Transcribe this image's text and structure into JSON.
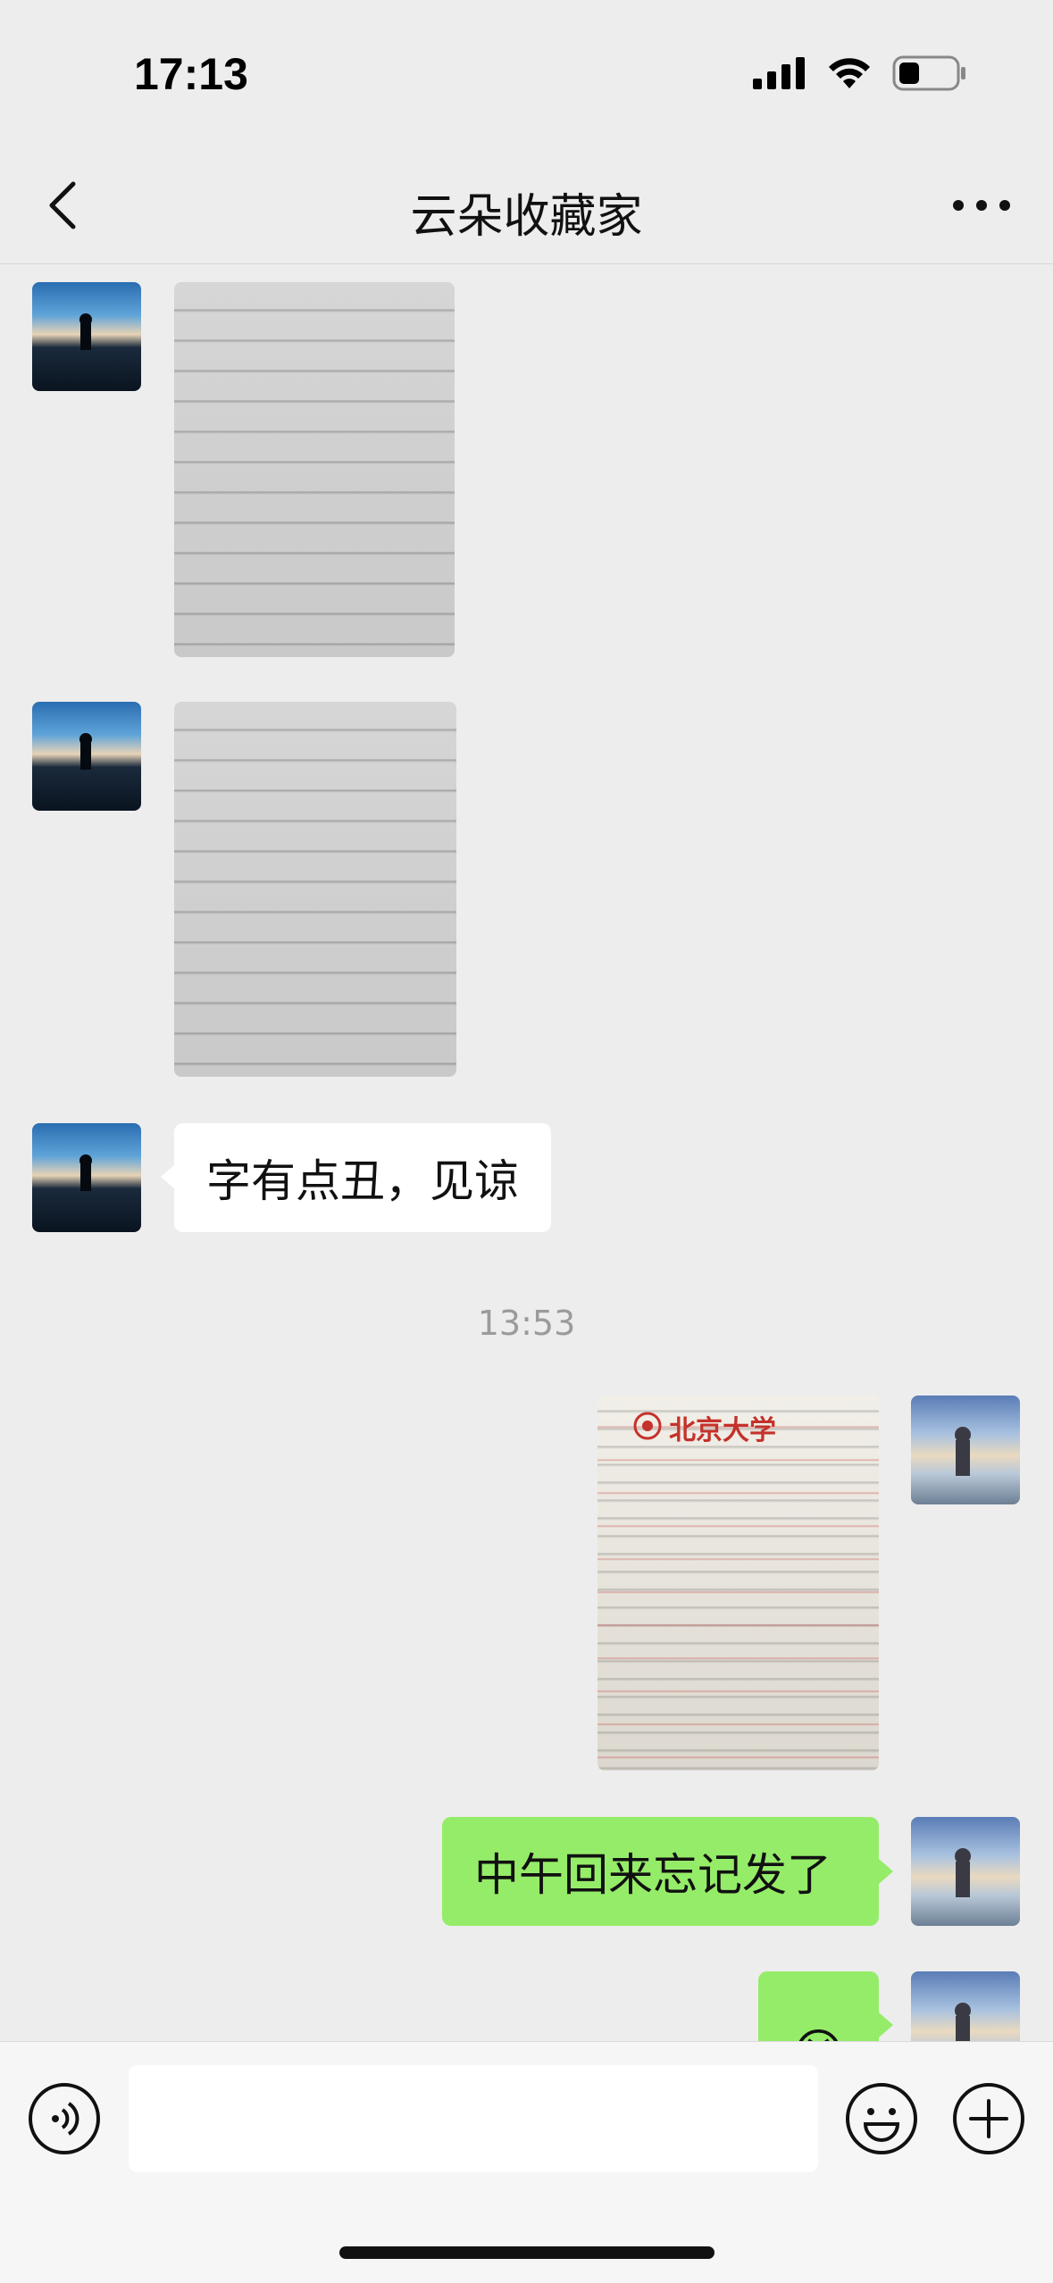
{
  "status_bar": {
    "time": "17:13"
  },
  "header": {
    "title": "云朵收藏家"
  },
  "messages": [
    {
      "type": "image",
      "side": "left",
      "description_icon": "handwritten-notes-photo"
    },
    {
      "type": "image",
      "side": "left",
      "description_icon": "handwritten-notes-photo"
    },
    {
      "type": "text",
      "side": "left",
      "text": "字有点丑，见谅"
    },
    {
      "type": "timestamp",
      "text": "13:53"
    },
    {
      "type": "image",
      "side": "right",
      "description_icon": "peking-university-letter-photo",
      "letterhead": "北京大学"
    },
    {
      "type": "text",
      "side": "right",
      "text": "中午回来忘记发了"
    },
    {
      "type": "emoji",
      "side": "right",
      "text": "😭"
    }
  ],
  "colors": {
    "background": "#ededed",
    "bubble_self": "#95ec69",
    "bubble_other": "#ffffff",
    "timestamp": "#9b9b9b"
  }
}
